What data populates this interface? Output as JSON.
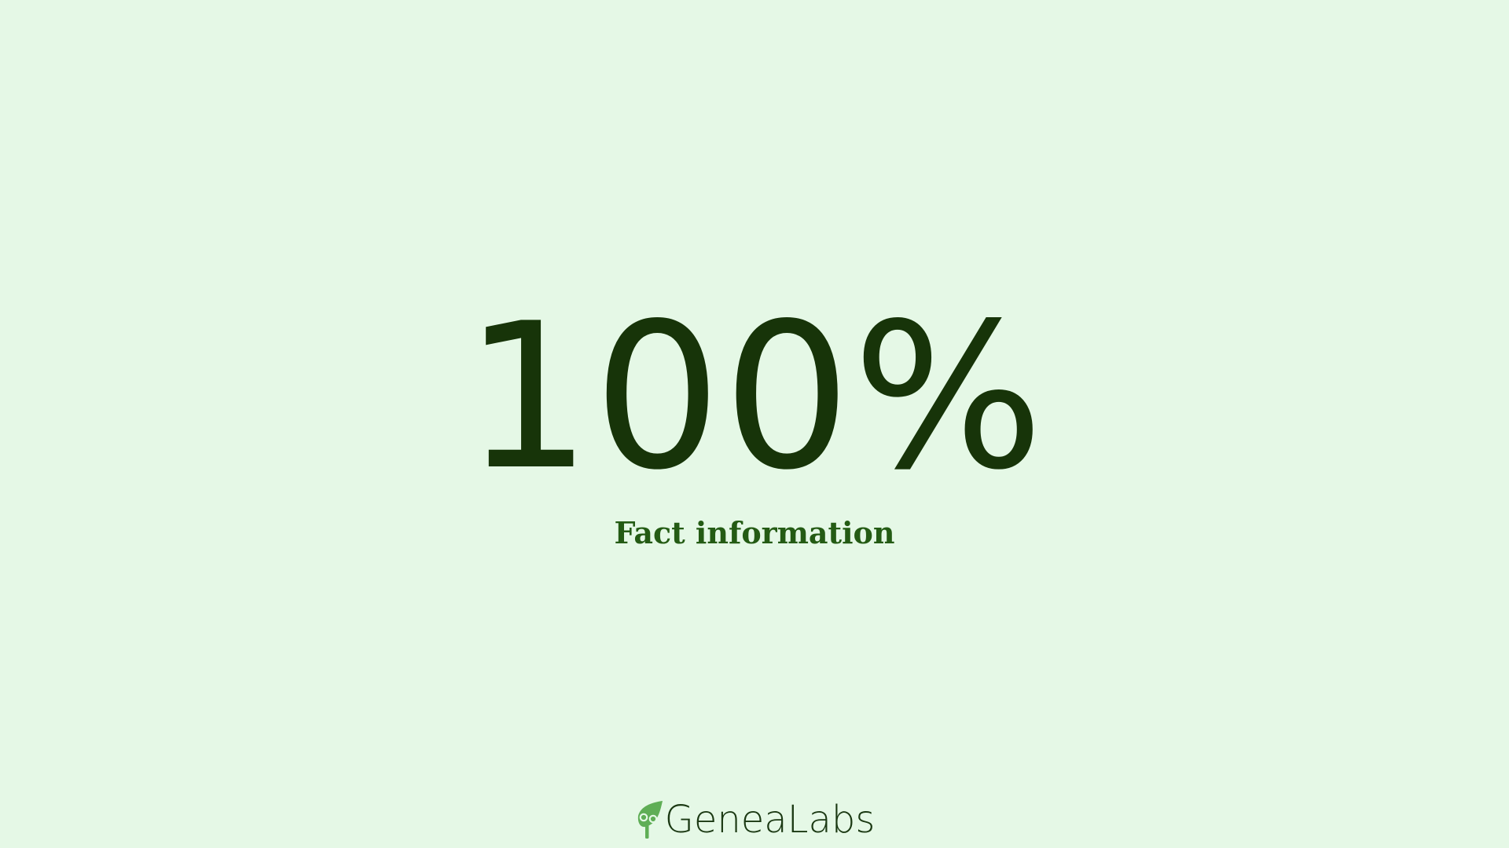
{
  "slide": {
    "value": "100%",
    "caption": "Fact information"
  },
  "brand": {
    "name": "GeneaLabs",
    "icon": "leaf-tree-icon"
  },
  "colors": {
    "background": "#e5f8e6",
    "value": "#173409",
    "caption": "#245b14",
    "brand_text": "#1a3812",
    "brand_icon": "#5fae56"
  }
}
